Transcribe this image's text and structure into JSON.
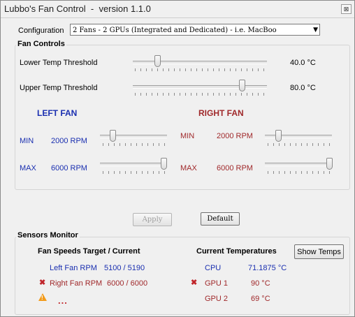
{
  "window": {
    "title": "Lubbo's Fan Control  -  version 1.1.0",
    "close_glyph": "⊠"
  },
  "configuration": {
    "label": "Configuration",
    "selected": "2 Fans - 2 GPUs (Integrated and Dedicated) - i.e. MacBoo"
  },
  "fan_controls": {
    "title": "Fan Controls",
    "lower_threshold": {
      "label": "Lower Temp Threshold",
      "value": "40.0 °C"
    },
    "upper_threshold": {
      "label": "Upper Temp Threshold",
      "value": "80.0 °C"
    },
    "left_fan": {
      "title": "LEFT FAN",
      "min_label": "MIN",
      "min_value": "2000 RPM",
      "max_label": "MAX",
      "max_value": "6000 RPM"
    },
    "right_fan": {
      "title": "RIGHT FAN",
      "min_label": "MIN",
      "min_value": "2000 RPM",
      "max_label": "MAX",
      "max_value": "6000 RPM"
    }
  },
  "buttons": {
    "apply": "Apply",
    "default": "Default",
    "show_temps": "Show Temps"
  },
  "sensors": {
    "title": "Sensors Monitor",
    "fan_header": "Fan Speeds Target / Current",
    "temp_header": "Current Temperatures",
    "left_fan_label": "Left  Fan RPM",
    "left_fan_value": "5100 / 5190",
    "right_fan_label": "Right Fan RPM",
    "right_fan_value": "6000 / 6000",
    "cpu_label": "CPU",
    "cpu_value": "71.1875 °C",
    "gpu1_label": "GPU 1",
    "gpu1_value": "90 °C",
    "gpu2_label": "GPU 2",
    "gpu2_value": "69 °C",
    "warning_dots": "..."
  },
  "colors": {
    "left_accent": "#1a2fb0",
    "right_accent": "#a0292b",
    "warning": "#f29b1b"
  },
  "icons": [
    "close-icon",
    "dropdown-arrow-icon",
    "error-x-icon",
    "warning-icon"
  ]
}
